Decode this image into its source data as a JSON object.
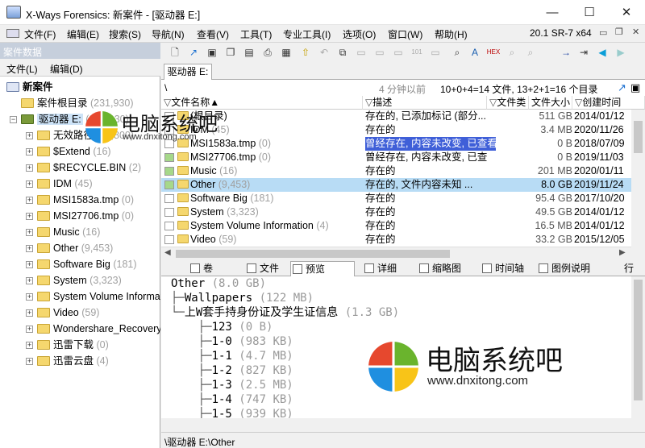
{
  "window": {
    "title": "X-Ways Forensics: 新案件 - [驱动器 E:]",
    "minimize": "—",
    "maximize": "☐",
    "close": "✕"
  },
  "menu": [
    "文件(F)",
    "编辑(E)",
    "搜索(S)",
    "导航(N)",
    "查看(V)",
    "工具(T)",
    "专业工具(I)",
    "选项(O)",
    "窗口(W)",
    "帮助(H)"
  ],
  "version": "20.1 SR-7 x64",
  "case_pane": {
    "title": "案件数据",
    "menu": [
      "文件(L)",
      "编辑(D)"
    ],
    "tree": [
      {
        "label": "新案件",
        "count": "",
        "level": 0
      },
      {
        "label": "案件根目录",
        "count": "(231,930)",
        "level": 1
      },
      {
        "label": "驱动器 E:",
        "count": "(231,930)",
        "level": 1
      },
      {
        "label": "无效路径",
        "count": "(81,800)",
        "level": 2
      },
      {
        "label": "$Extend",
        "count": "(16)",
        "level": 2
      },
      {
        "label": "$RECYCLE.BIN",
        "count": "(2)",
        "level": 2
      },
      {
        "label": "IDM",
        "count": "(45)",
        "level": 2
      },
      {
        "label": "MSI1583a.tmp",
        "count": "(0)",
        "level": 2
      },
      {
        "label": "MSI27706.tmp",
        "count": "(0)",
        "level": 2
      },
      {
        "label": "Music",
        "count": "(16)",
        "level": 2
      },
      {
        "label": "Other",
        "count": "(9,453)",
        "level": 2
      },
      {
        "label": "Software Big",
        "count": "(181)",
        "level": 2
      },
      {
        "label": "System",
        "count": "(3,323)",
        "level": 2
      },
      {
        "label": "System Volume Information",
        "count": "(4)",
        "level": 2
      },
      {
        "label": "Video",
        "count": "(59)",
        "level": 2
      },
      {
        "label": "Wondershare_Recovery",
        "count": "",
        "level": 2
      },
      {
        "label": "迅雷下载",
        "count": "(0)",
        "level": 2
      },
      {
        "label": "迅雷云盘",
        "count": "(4)",
        "level": 2
      }
    ]
  },
  "tab": "驱动器 E:",
  "pathbar": {
    "path": "\\",
    "ago": "4 分钟以前",
    "summary": "10+0+4=14 文件, 13+2+1=16 个目录"
  },
  "columns": [
    "文件名称",
    "描述",
    "文件类",
    "文件大小",
    "创建时间"
  ],
  "rows": [
    {
      "name": "(根目录)",
      "count": "",
      "desc": "存在的, 已添加标记 (部分...",
      "type": "",
      "size": "511 GB",
      "created": "2014/01/12",
      "desc_sel": false,
      "sel": false
    },
    {
      "name": "IDM",
      "count": "(45)",
      "desc": "存在的",
      "type": "",
      "size": "3.4 MB",
      "created": "2020/11/26",
      "desc_sel": false,
      "sel": false
    },
    {
      "name": "MSI1583a.tmp",
      "count": "(0)",
      "desc": "曾经存在, 内容未改变, 已查看",
      "type": "",
      "size": "0 B",
      "created": "2018/07/09",
      "desc_sel": true,
      "sel": false
    },
    {
      "name": "MSI27706.tmp",
      "count": "(0)",
      "desc": "曾经存在, 内容未改变, 已查...",
      "type": "",
      "size": "0 B",
      "created": "2019/11/03",
      "desc_sel": false,
      "sel": false
    },
    {
      "name": "Music",
      "count": "(16)",
      "desc": "存在的",
      "type": "",
      "size": "201 MB",
      "created": "2020/01/11",
      "desc_sel": false,
      "sel": false
    },
    {
      "name": "Other",
      "count": "(9,453)",
      "desc": "存在的, 文件内容未知 ...",
      "type": "",
      "size": "8.0 GB",
      "created": "2019/11/24",
      "desc_sel": false,
      "sel": true
    },
    {
      "name": "Software Big",
      "count": "(181)",
      "desc": "存在的",
      "type": "",
      "size": "95.4 GB",
      "created": "2017/10/20",
      "desc_sel": false,
      "sel": false
    },
    {
      "name": "System",
      "count": "(3,323)",
      "desc": "存在的",
      "type": "",
      "size": "49.5 GB",
      "created": "2014/01/12",
      "desc_sel": false,
      "sel": false
    },
    {
      "name": "System Volume Information",
      "count": "(4)",
      "desc": "存在的",
      "type": "",
      "size": "16.5 MB",
      "created": "2014/01/12",
      "desc_sel": false,
      "sel": false
    },
    {
      "name": "Video",
      "count": "(59)",
      "desc": "存在的",
      "type": "",
      "size": "33.2 GB",
      "created": "2015/12/05",
      "desc_sel": false,
      "sel": false
    }
  ],
  "bottom_tabs": [
    "卷",
    "文件",
    "预览",
    "详细",
    "缩略图",
    "时间轴",
    "图例说明",
    "行"
  ],
  "preview": [
    {
      "indent": "",
      "name": "Other",
      "size": "(8.0 GB)"
    },
    {
      "indent": "├─",
      "name": "Wallpapers",
      "size": "(122 MB)"
    },
    {
      "indent": "└─",
      "name": "上W套手持身份证及学生证信息",
      "size": "(1.3 GB)"
    },
    {
      "indent": "    ├─",
      "name": "123",
      "size": "(0 B)"
    },
    {
      "indent": "    ├─",
      "name": "1-0",
      "size": "(983 KB)"
    },
    {
      "indent": "    ├─",
      "name": "1-1",
      "size": "(4.7 MB)"
    },
    {
      "indent": "    ├─",
      "name": "1-2",
      "size": "(827 KB)"
    },
    {
      "indent": "    ├─",
      "name": "1-3",
      "size": "(2.5 MB)"
    },
    {
      "indent": "    ├─",
      "name": "1-4",
      "size": "(747 KB)"
    },
    {
      "indent": "    ├─",
      "name": "1-5",
      "size": "(939 KB)"
    }
  ],
  "status": "\\驱动器 E:\\Other",
  "watermark": {
    "text": "电脑系统吧",
    "url": "www.dnxitong.com"
  }
}
